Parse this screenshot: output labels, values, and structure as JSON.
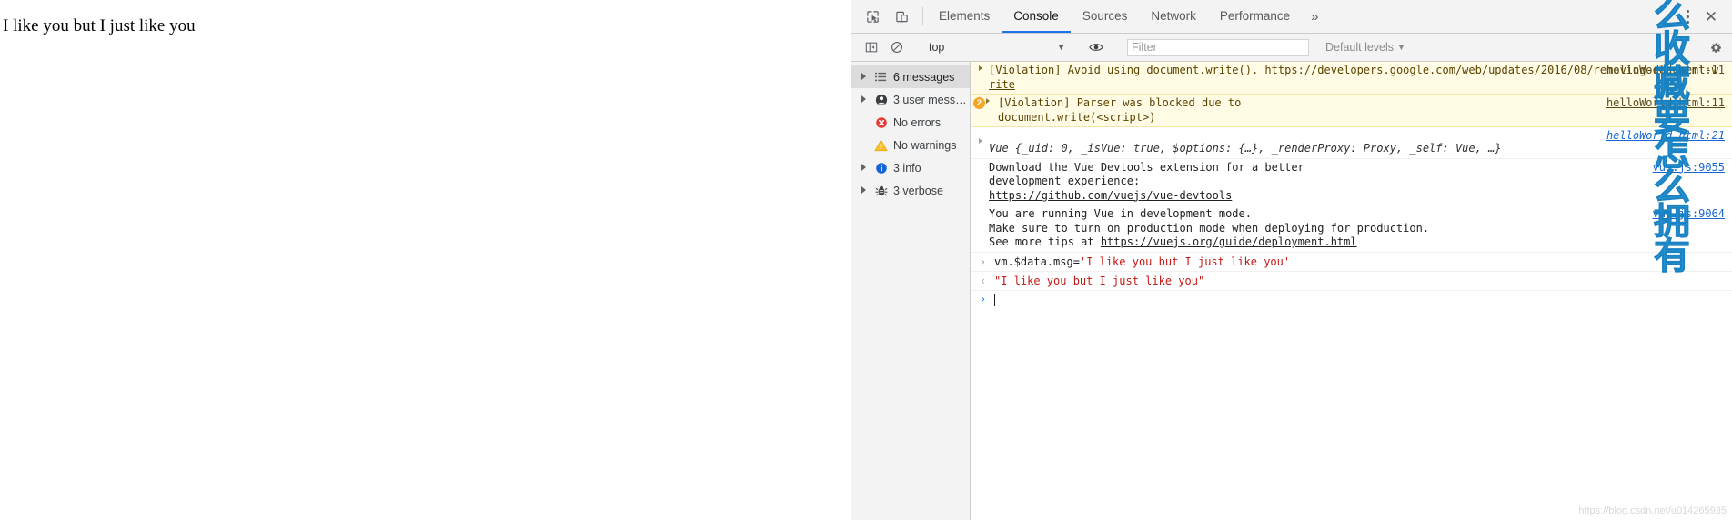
{
  "page": {
    "rendered_text": "I like you but I just like you"
  },
  "devtools": {
    "toolbar": {
      "inspect_icon": "inspect-cursor-icon",
      "device_toggle_icon": "device-toolbar-icon",
      "tabs": [
        {
          "label": "Elements",
          "active": false
        },
        {
          "label": "Console",
          "active": true
        },
        {
          "label": "Sources",
          "active": false
        },
        {
          "label": "Network",
          "active": false
        },
        {
          "label": "Performance",
          "active": false
        }
      ],
      "more_tabs_label": "»",
      "menu_icon": "kebab-menu-icon",
      "close_icon": "close-icon"
    },
    "filterbar": {
      "sidebar_toggle_icon": "console-sidebar-toggle-icon",
      "clear_icon": "clear-console-icon",
      "context_value": "top",
      "context_caret": "▼",
      "eye_icon": "live-expression-eye-icon",
      "filter_placeholder": "Filter",
      "filter_value": "",
      "levels_label": "Default levels",
      "levels_caret": "▼",
      "settings_icon": "settings-gear-icon"
    },
    "sidebar": [
      {
        "label": "6 messages",
        "icon": "list-icon",
        "expandable": true,
        "selected": true
      },
      {
        "label": "3 user mess…",
        "icon": "user-icon",
        "expandable": true,
        "selected": false
      },
      {
        "label": "No errors",
        "icon": "error-icon",
        "expandable": false,
        "selected": false
      },
      {
        "label": "No warnings",
        "icon": "warning-icon",
        "expandable": false,
        "selected": false
      },
      {
        "label": "3 info",
        "icon": "info-icon",
        "expandable": true,
        "selected": false
      },
      {
        "label": "3 verbose",
        "icon": "bug-icon",
        "expandable": true,
        "selected": false
      }
    ],
    "messages": [
      {
        "kind": "violation",
        "count": null,
        "text": "[Violation] Avoid using document.write(). http",
        "link_text": "s://developers.google.com/web/updates/2016/08/removing-document-write",
        "source": "helloWorld.html:11"
      },
      {
        "kind": "violation",
        "count": "2",
        "text": "[Violation] Parser was blocked due to\ndocument.write(<script>)",
        "link_text": "",
        "source": "helloWorld.html:11"
      },
      {
        "kind": "object",
        "count": null,
        "text": "Vue {_uid: 0, _isVue: true, $options: {…}, _renderProxy: Proxy, _self: Vue, …}",
        "link_text": "",
        "source": "helloWorld.html:21"
      },
      {
        "kind": "info",
        "count": null,
        "text": "Download the Vue Devtools extension for a better\ndevelopment experience:",
        "link_text": "https://github.com/vuejs/vue-devtools",
        "source": "vue.js:9055"
      },
      {
        "kind": "info",
        "count": null,
        "text": "You are running Vue in development mode.\nMake sure to turn on production mode when deploying for production.\nSee more tips at ",
        "link_text": "https://vuejs.org/guide/deployment.html",
        "source": "vue.js:9064"
      }
    ],
    "evaluation": {
      "input_arrow": "›",
      "input_prefix": "vm.$data.msg=",
      "input_string": "'I like you but I just like you'",
      "result_arrow": "‹",
      "result_value": "\"I like you but I just like you\"",
      "prompt_arrow": "›",
      "prompt_value": ""
    }
  },
  "watermarks": {
    "vertical_text": "么收藏要怎么拥有",
    "url_text": "https://blog.csdn.net/u014265935"
  },
  "colors": {
    "accent": "#1a73e8",
    "violation_bg": "#fffbe5",
    "string_red": "#c41a16",
    "watermark_blue": "#2196d6"
  }
}
